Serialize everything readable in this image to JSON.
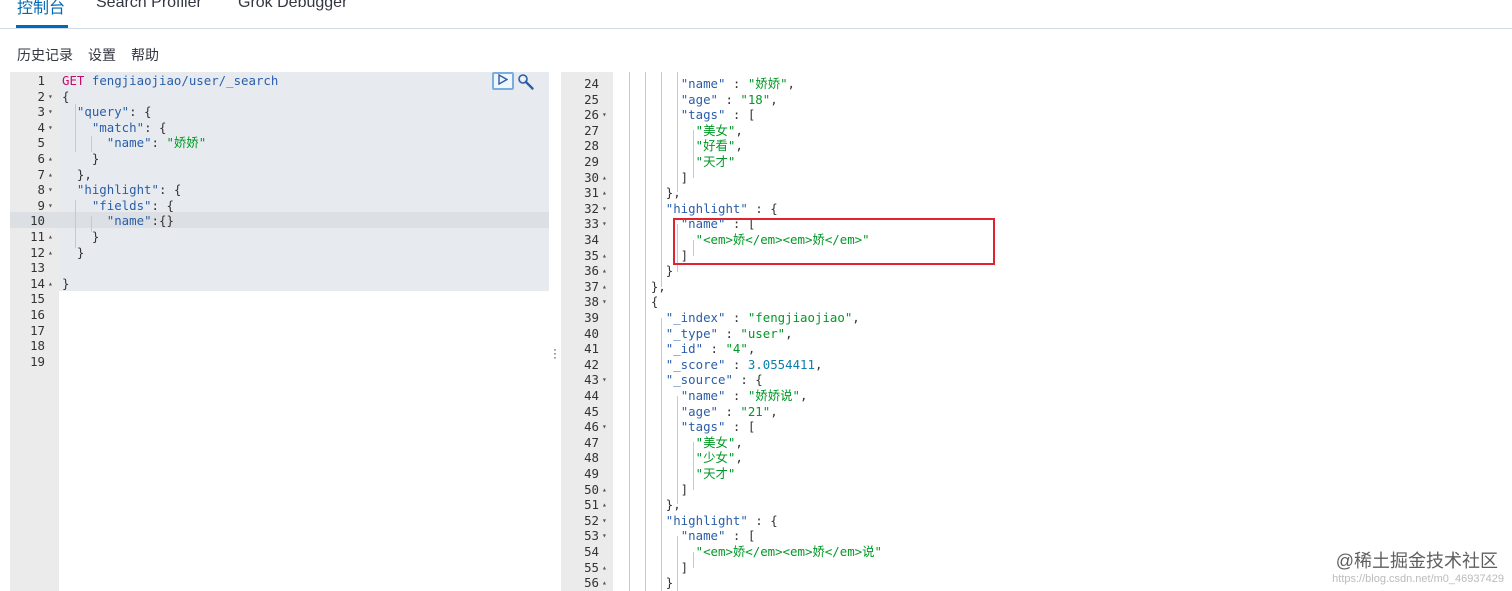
{
  "tabs": [
    {
      "label": "控制台",
      "active": true
    },
    {
      "label": "Search Profiler",
      "active": false
    },
    {
      "label": "Grok Debugger",
      "active": false
    }
  ],
  "menu": [
    "历史记录",
    "设置",
    "帮助"
  ],
  "colors": {
    "accent": "#006bb4",
    "highlight_box": "#e0242f"
  },
  "request": {
    "lines": [
      {
        "n": "1",
        "fold": "",
        "tokens": [
          [
            "c-method",
            "GET"
          ],
          [
            "c-punc",
            " "
          ],
          [
            "c-url",
            "fengjiaojiao/user/_search"
          ]
        ]
      },
      {
        "n": "2",
        "fold": "▾",
        "tokens": [
          [
            "c-punc",
            "{"
          ]
        ]
      },
      {
        "n": "3",
        "fold": "▾",
        "tokens": [
          [
            "c-punc",
            "  "
          ],
          [
            "c-key",
            "\"query\""
          ],
          [
            "c-punc",
            ": {"
          ]
        ]
      },
      {
        "n": "4",
        "fold": "▾",
        "tokens": [
          [
            "c-punc",
            "    "
          ],
          [
            "c-key",
            "\"match\""
          ],
          [
            "c-punc",
            ": {"
          ]
        ]
      },
      {
        "n": "5",
        "fold": "",
        "tokens": [
          [
            "c-punc",
            "      "
          ],
          [
            "c-key",
            "\"name\""
          ],
          [
            "c-punc",
            ": "
          ],
          [
            "c-str",
            "\"娇娇\""
          ]
        ]
      },
      {
        "n": "6",
        "fold": "▴",
        "tokens": [
          [
            "c-punc",
            "    }"
          ]
        ]
      },
      {
        "n": "7",
        "fold": "▴",
        "tokens": [
          [
            "c-punc",
            "  },"
          ]
        ]
      },
      {
        "n": "8",
        "fold": "▾",
        "tokens": [
          [
            "c-punc",
            "  "
          ],
          [
            "c-key",
            "\"highlight\""
          ],
          [
            "c-punc",
            ": {"
          ]
        ]
      },
      {
        "n": "9",
        "fold": "▾",
        "tokens": [
          [
            "c-punc",
            "    "
          ],
          [
            "c-key",
            "\"fields\""
          ],
          [
            "c-punc",
            ": {"
          ]
        ]
      },
      {
        "n": "10",
        "fold": "",
        "tokens": [
          [
            "c-punc",
            "      "
          ],
          [
            "c-key",
            "\"name\""
          ],
          [
            "c-punc",
            ":{}"
          ]
        ]
      },
      {
        "n": "11",
        "fold": "▴",
        "tokens": [
          [
            "c-punc",
            "    }"
          ]
        ]
      },
      {
        "n": "12",
        "fold": "▴",
        "tokens": [
          [
            "c-punc",
            "  }"
          ]
        ]
      },
      {
        "n": "13",
        "fold": "",
        "tokens": []
      },
      {
        "n": "14",
        "fold": "▴",
        "tokens": [
          [
            "c-punc",
            "}"
          ]
        ]
      },
      {
        "n": "15",
        "fold": "",
        "tokens": []
      },
      {
        "n": "16",
        "fold": "",
        "tokens": []
      },
      {
        "n": "17",
        "fold": "",
        "tokens": []
      },
      {
        "n": "18",
        "fold": "",
        "tokens": []
      },
      {
        "n": "19",
        "fold": "",
        "tokens": []
      }
    ]
  },
  "response": {
    "lines": [
      {
        "n": "24",
        "fold": "",
        "tokens": [
          [
            "c-punc",
            "        "
          ],
          [
            "c-key",
            "\"name\""
          ],
          [
            "c-punc",
            " : "
          ],
          [
            "c-str",
            "\"娇娇\""
          ],
          [
            "c-punc",
            ","
          ]
        ]
      },
      {
        "n": "25",
        "fold": "",
        "tokens": [
          [
            "c-punc",
            "        "
          ],
          [
            "c-key",
            "\"age\""
          ],
          [
            "c-punc",
            " : "
          ],
          [
            "c-str",
            "\"18\""
          ],
          [
            "c-punc",
            ","
          ]
        ]
      },
      {
        "n": "26",
        "fold": "▾",
        "tokens": [
          [
            "c-punc",
            "        "
          ],
          [
            "c-key",
            "\"tags\""
          ],
          [
            "c-punc",
            " : ["
          ]
        ]
      },
      {
        "n": "27",
        "fold": "",
        "tokens": [
          [
            "c-punc",
            "          "
          ],
          [
            "c-str",
            "\"美女\""
          ],
          [
            "c-punc",
            ","
          ]
        ]
      },
      {
        "n": "28",
        "fold": "",
        "tokens": [
          [
            "c-punc",
            "          "
          ],
          [
            "c-str",
            "\"好看\""
          ],
          [
            "c-punc",
            ","
          ]
        ]
      },
      {
        "n": "29",
        "fold": "",
        "tokens": [
          [
            "c-punc",
            "          "
          ],
          [
            "c-str",
            "\"天才\""
          ]
        ]
      },
      {
        "n": "30",
        "fold": "▴",
        "tokens": [
          [
            "c-punc",
            "        ]"
          ]
        ]
      },
      {
        "n": "31",
        "fold": "▴",
        "tokens": [
          [
            "c-punc",
            "      },"
          ]
        ]
      },
      {
        "n": "32",
        "fold": "▾",
        "tokens": [
          [
            "c-punc",
            "      "
          ],
          [
            "c-key",
            "\"highlight\""
          ],
          [
            "c-punc",
            " : {"
          ]
        ]
      },
      {
        "n": "33",
        "fold": "▾",
        "tokens": [
          [
            "c-punc",
            "        "
          ],
          [
            "c-key",
            "\"name\""
          ],
          [
            "c-punc",
            " : ["
          ]
        ]
      },
      {
        "n": "34",
        "fold": "",
        "tokens": [
          [
            "c-punc",
            "          "
          ],
          [
            "c-str",
            "\"<em>娇</em><em>娇</em>\""
          ]
        ]
      },
      {
        "n": "35",
        "fold": "▴",
        "tokens": [
          [
            "c-punc",
            "        ]"
          ]
        ]
      },
      {
        "n": "36",
        "fold": "▴",
        "tokens": [
          [
            "c-punc",
            "      }"
          ]
        ]
      },
      {
        "n": "37",
        "fold": "▴",
        "tokens": [
          [
            "c-punc",
            "    },"
          ]
        ]
      },
      {
        "n": "38",
        "fold": "▾",
        "tokens": [
          [
            "c-punc",
            "    {"
          ]
        ]
      },
      {
        "n": "39",
        "fold": "",
        "tokens": [
          [
            "c-punc",
            "      "
          ],
          [
            "c-key",
            "\"_index\""
          ],
          [
            "c-punc",
            " : "
          ],
          [
            "c-str",
            "\"fengjiaojiao\""
          ],
          [
            "c-punc",
            ","
          ]
        ]
      },
      {
        "n": "40",
        "fold": "",
        "tokens": [
          [
            "c-punc",
            "      "
          ],
          [
            "c-key",
            "\"_type\""
          ],
          [
            "c-punc",
            " : "
          ],
          [
            "c-str",
            "\"user\""
          ],
          [
            "c-punc",
            ","
          ]
        ]
      },
      {
        "n": "41",
        "fold": "",
        "tokens": [
          [
            "c-punc",
            "      "
          ],
          [
            "c-key",
            "\"_id\""
          ],
          [
            "c-punc",
            " : "
          ],
          [
            "c-str",
            "\"4\""
          ],
          [
            "c-punc",
            ","
          ]
        ]
      },
      {
        "n": "42",
        "fold": "",
        "tokens": [
          [
            "c-punc",
            "      "
          ],
          [
            "c-key",
            "\"_score\""
          ],
          [
            "c-punc",
            " : "
          ],
          [
            "c-num",
            "3.0554411"
          ],
          [
            "c-punc",
            ","
          ]
        ]
      },
      {
        "n": "43",
        "fold": "▾",
        "tokens": [
          [
            "c-punc",
            "      "
          ],
          [
            "c-key",
            "\"_source\""
          ],
          [
            "c-punc",
            " : {"
          ]
        ]
      },
      {
        "n": "44",
        "fold": "",
        "tokens": [
          [
            "c-punc",
            "        "
          ],
          [
            "c-key",
            "\"name\""
          ],
          [
            "c-punc",
            " : "
          ],
          [
            "c-str",
            "\"娇娇说\""
          ],
          [
            "c-punc",
            ","
          ]
        ]
      },
      {
        "n": "45",
        "fold": "",
        "tokens": [
          [
            "c-punc",
            "        "
          ],
          [
            "c-key",
            "\"age\""
          ],
          [
            "c-punc",
            " : "
          ],
          [
            "c-str",
            "\"21\""
          ],
          [
            "c-punc",
            ","
          ]
        ]
      },
      {
        "n": "46",
        "fold": "▾",
        "tokens": [
          [
            "c-punc",
            "        "
          ],
          [
            "c-key",
            "\"tags\""
          ],
          [
            "c-punc",
            " : ["
          ]
        ]
      },
      {
        "n": "47",
        "fold": "",
        "tokens": [
          [
            "c-punc",
            "          "
          ],
          [
            "c-str",
            "\"美女\""
          ],
          [
            "c-punc",
            ","
          ]
        ]
      },
      {
        "n": "48",
        "fold": "",
        "tokens": [
          [
            "c-punc",
            "          "
          ],
          [
            "c-str",
            "\"少女\""
          ],
          [
            "c-punc",
            ","
          ]
        ]
      },
      {
        "n": "49",
        "fold": "",
        "tokens": [
          [
            "c-punc",
            "          "
          ],
          [
            "c-str",
            "\"天才\""
          ]
        ]
      },
      {
        "n": "50",
        "fold": "▴",
        "tokens": [
          [
            "c-punc",
            "        ]"
          ]
        ]
      },
      {
        "n": "51",
        "fold": "▴",
        "tokens": [
          [
            "c-punc",
            "      },"
          ]
        ]
      },
      {
        "n": "52",
        "fold": "▾",
        "tokens": [
          [
            "c-punc",
            "      "
          ],
          [
            "c-key",
            "\"highlight\""
          ],
          [
            "c-punc",
            " : {"
          ]
        ]
      },
      {
        "n": "53",
        "fold": "▾",
        "tokens": [
          [
            "c-punc",
            "        "
          ],
          [
            "c-key",
            "\"name\""
          ],
          [
            "c-punc",
            " : ["
          ]
        ]
      },
      {
        "n": "54",
        "fold": "",
        "tokens": [
          [
            "c-punc",
            "          "
          ],
          [
            "c-str",
            "\"<em>娇</em><em>娇</em>说\""
          ]
        ]
      },
      {
        "n": "55",
        "fold": "▴",
        "tokens": [
          [
            "c-punc",
            "        ]"
          ]
        ]
      },
      {
        "n": "56",
        "fold": "▴",
        "tokens": [
          [
            "c-punc",
            "      }"
          ]
        ]
      }
    ]
  },
  "watermark": {
    "text": "@稀土掘金技术社区",
    "sub": "https://blog.csdn.net/m0_46937429"
  }
}
